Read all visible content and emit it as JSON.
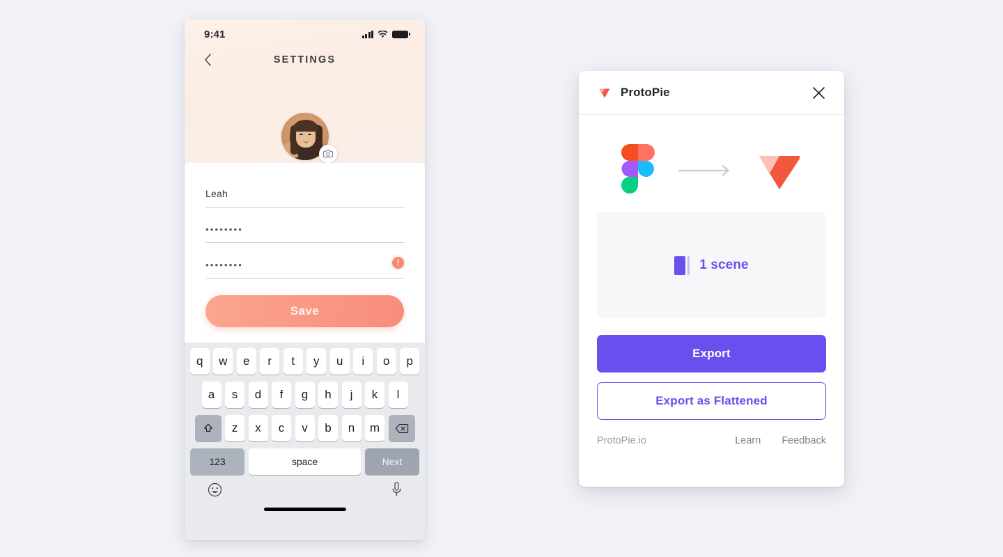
{
  "background_color": "#F1F2F7",
  "phone": {
    "status_bar": {
      "time": "9:41",
      "icons": [
        "signal-bars-icon",
        "wifi-icon",
        "battery-icon"
      ]
    },
    "nav": {
      "back_icon": "chevron-left-icon",
      "title": "SETTINGS"
    },
    "avatar": {
      "name": "avatar",
      "badge_icon": "camera-icon"
    },
    "form": {
      "fields": [
        {
          "name": "name-field",
          "value": "Leah",
          "type": "text"
        },
        {
          "name": "password-field",
          "value": "••••••••",
          "type": "password"
        },
        {
          "name": "confirm-password-field",
          "value": "••••••••",
          "type": "password",
          "error": true,
          "error_glyph": "!"
        }
      ],
      "save_label": "Save"
    },
    "keyboard": {
      "row1": [
        "q",
        "w",
        "e",
        "r",
        "t",
        "y",
        "u",
        "i",
        "o",
        "p"
      ],
      "row2": [
        "a",
        "s",
        "d",
        "f",
        "g",
        "h",
        "j",
        "k",
        "l"
      ],
      "row3": [
        "z",
        "x",
        "c",
        "v",
        "b",
        "n",
        "m"
      ],
      "shift_icon": "shift-up-arrow-icon",
      "backspace_icon": "backspace-delete-icon",
      "numbers_label": "123",
      "space_label": "space",
      "return_label": "Next",
      "emoji_icon": "emoji-smiley-icon",
      "mic_icon": "microphone-icon"
    },
    "colors": {
      "header_gradient_start": "#FDF0E8",
      "header_gradient_end": "#F9EFE9",
      "save_gradient_start": "#FAA68D",
      "save_gradient_end": "#F98C7B",
      "field_underline": "#D9C3B8",
      "error_badge": "#F58A6E"
    }
  },
  "dialog": {
    "header": {
      "logo_icon": "protopie-logo-icon",
      "title": "ProtoPie",
      "close_icon": "close-x-icon"
    },
    "convert": {
      "from_icon": "figma-logo-icon",
      "arrow_icon": "arrow-right-icon",
      "to_icon": "protopie-logo-icon"
    },
    "scene_summary": {
      "icon": "scene-frame-icon",
      "label": "1 scene",
      "count": 1
    },
    "buttons": {
      "primary": "Export",
      "secondary": "Export as Flattened"
    },
    "footer": {
      "site": "ProtoPie.io",
      "links": [
        "Learn",
        "Feedback"
      ]
    },
    "colors": {
      "accent": "#6950EE",
      "scene_box_bg": "#F7F7FA",
      "footer_text": "#9A9AA2"
    }
  }
}
